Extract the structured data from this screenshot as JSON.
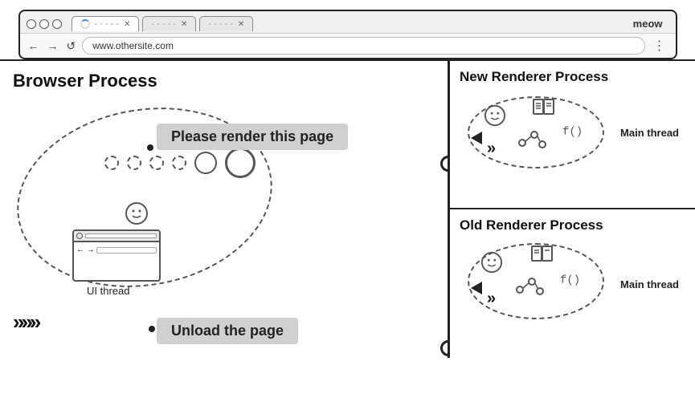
{
  "browser": {
    "tab1_text": "· · · · · ·",
    "tab2_text": "· · · · · ·",
    "tab3_text": "· · · · · ·",
    "meow": "meow",
    "address": "www.othersite.com",
    "nav_back": "←",
    "nav_forward": "→",
    "nav_refresh": "↺",
    "menu_dots": "⋮"
  },
  "diagram": {
    "browser_process_title": "Browser Process",
    "new_renderer_title": "New Renderer Process",
    "old_renderer_title": "Old Renderer Process",
    "message_render": "Please render this page",
    "message_unload": "Unload the page",
    "ui_thread_label": "UI thread",
    "main_thread_label": "Main thread",
    "arrows": "»»»"
  }
}
